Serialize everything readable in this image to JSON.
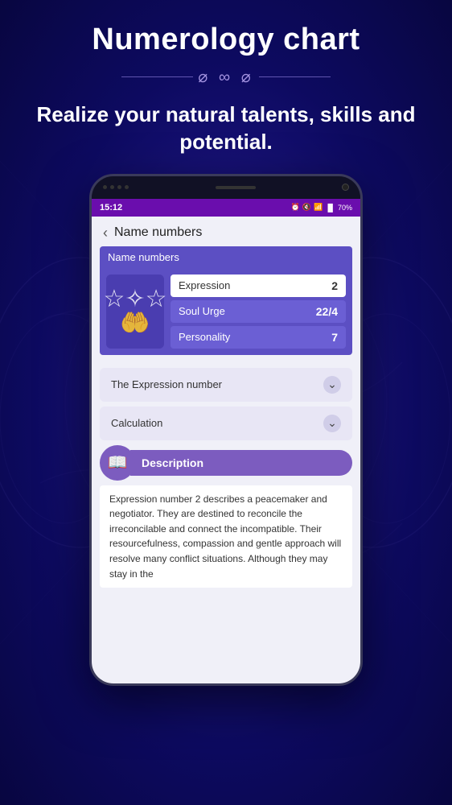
{
  "page": {
    "title": "Numerology chart",
    "subtitle": "Realize your natural talents, skills and potential.",
    "ornament": "∿∿"
  },
  "phone": {
    "status_time": "15:12",
    "battery": "70%",
    "nav_title": "Name numbers",
    "name_numbers_header": "Name numbers",
    "rows": [
      {
        "label": "Expression",
        "value": "2",
        "selected": true
      },
      {
        "label": "Soul Urge",
        "value": "22/4",
        "selected": false
      },
      {
        "label": "Personality",
        "value": "7",
        "selected": false
      }
    ],
    "accordion": [
      {
        "label": "The Expression number"
      },
      {
        "label": "Calculation"
      }
    ],
    "description_btn": "Description",
    "description_text": "Expression number 2 describes a peacemaker and negotiator. They are destined to reconcile the irreconcilable and connect the incompatible. Their resourcefulness, compassion and gentle approach will resolve many conflict situations. Although they may stay in the"
  },
  "colors": {
    "background": "#1a1080",
    "phone_accent": "#5c4fc3",
    "description_btn": "#7c5cbf"
  }
}
